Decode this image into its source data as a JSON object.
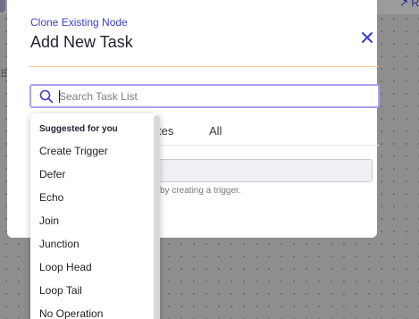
{
  "background": {
    "corner_icon": "↗ R"
  },
  "modal": {
    "clone_link": "Clone Existing Node",
    "title": "Add New Task",
    "close_icon": "close-icon",
    "search": {
      "placeholder": "Search Task List",
      "value": ""
    },
    "tabs": [
      {
        "label": "tes"
      },
      {
        "label": "All"
      }
    ],
    "hint_text": "by creating a trigger."
  },
  "dropdown": {
    "header": "Suggested for you",
    "items": [
      {
        "label": "Create Trigger"
      },
      {
        "label": "Defer"
      },
      {
        "label": "Echo"
      },
      {
        "label": "Join"
      },
      {
        "label": "Junction"
      },
      {
        "label": "Loop Head"
      },
      {
        "label": "Loop Tail"
      },
      {
        "label": "No Operation"
      }
    ]
  },
  "colors": {
    "accent": "#3a3ec9",
    "divider": "#f0c98c",
    "search_border": "#a9a3ef"
  }
}
